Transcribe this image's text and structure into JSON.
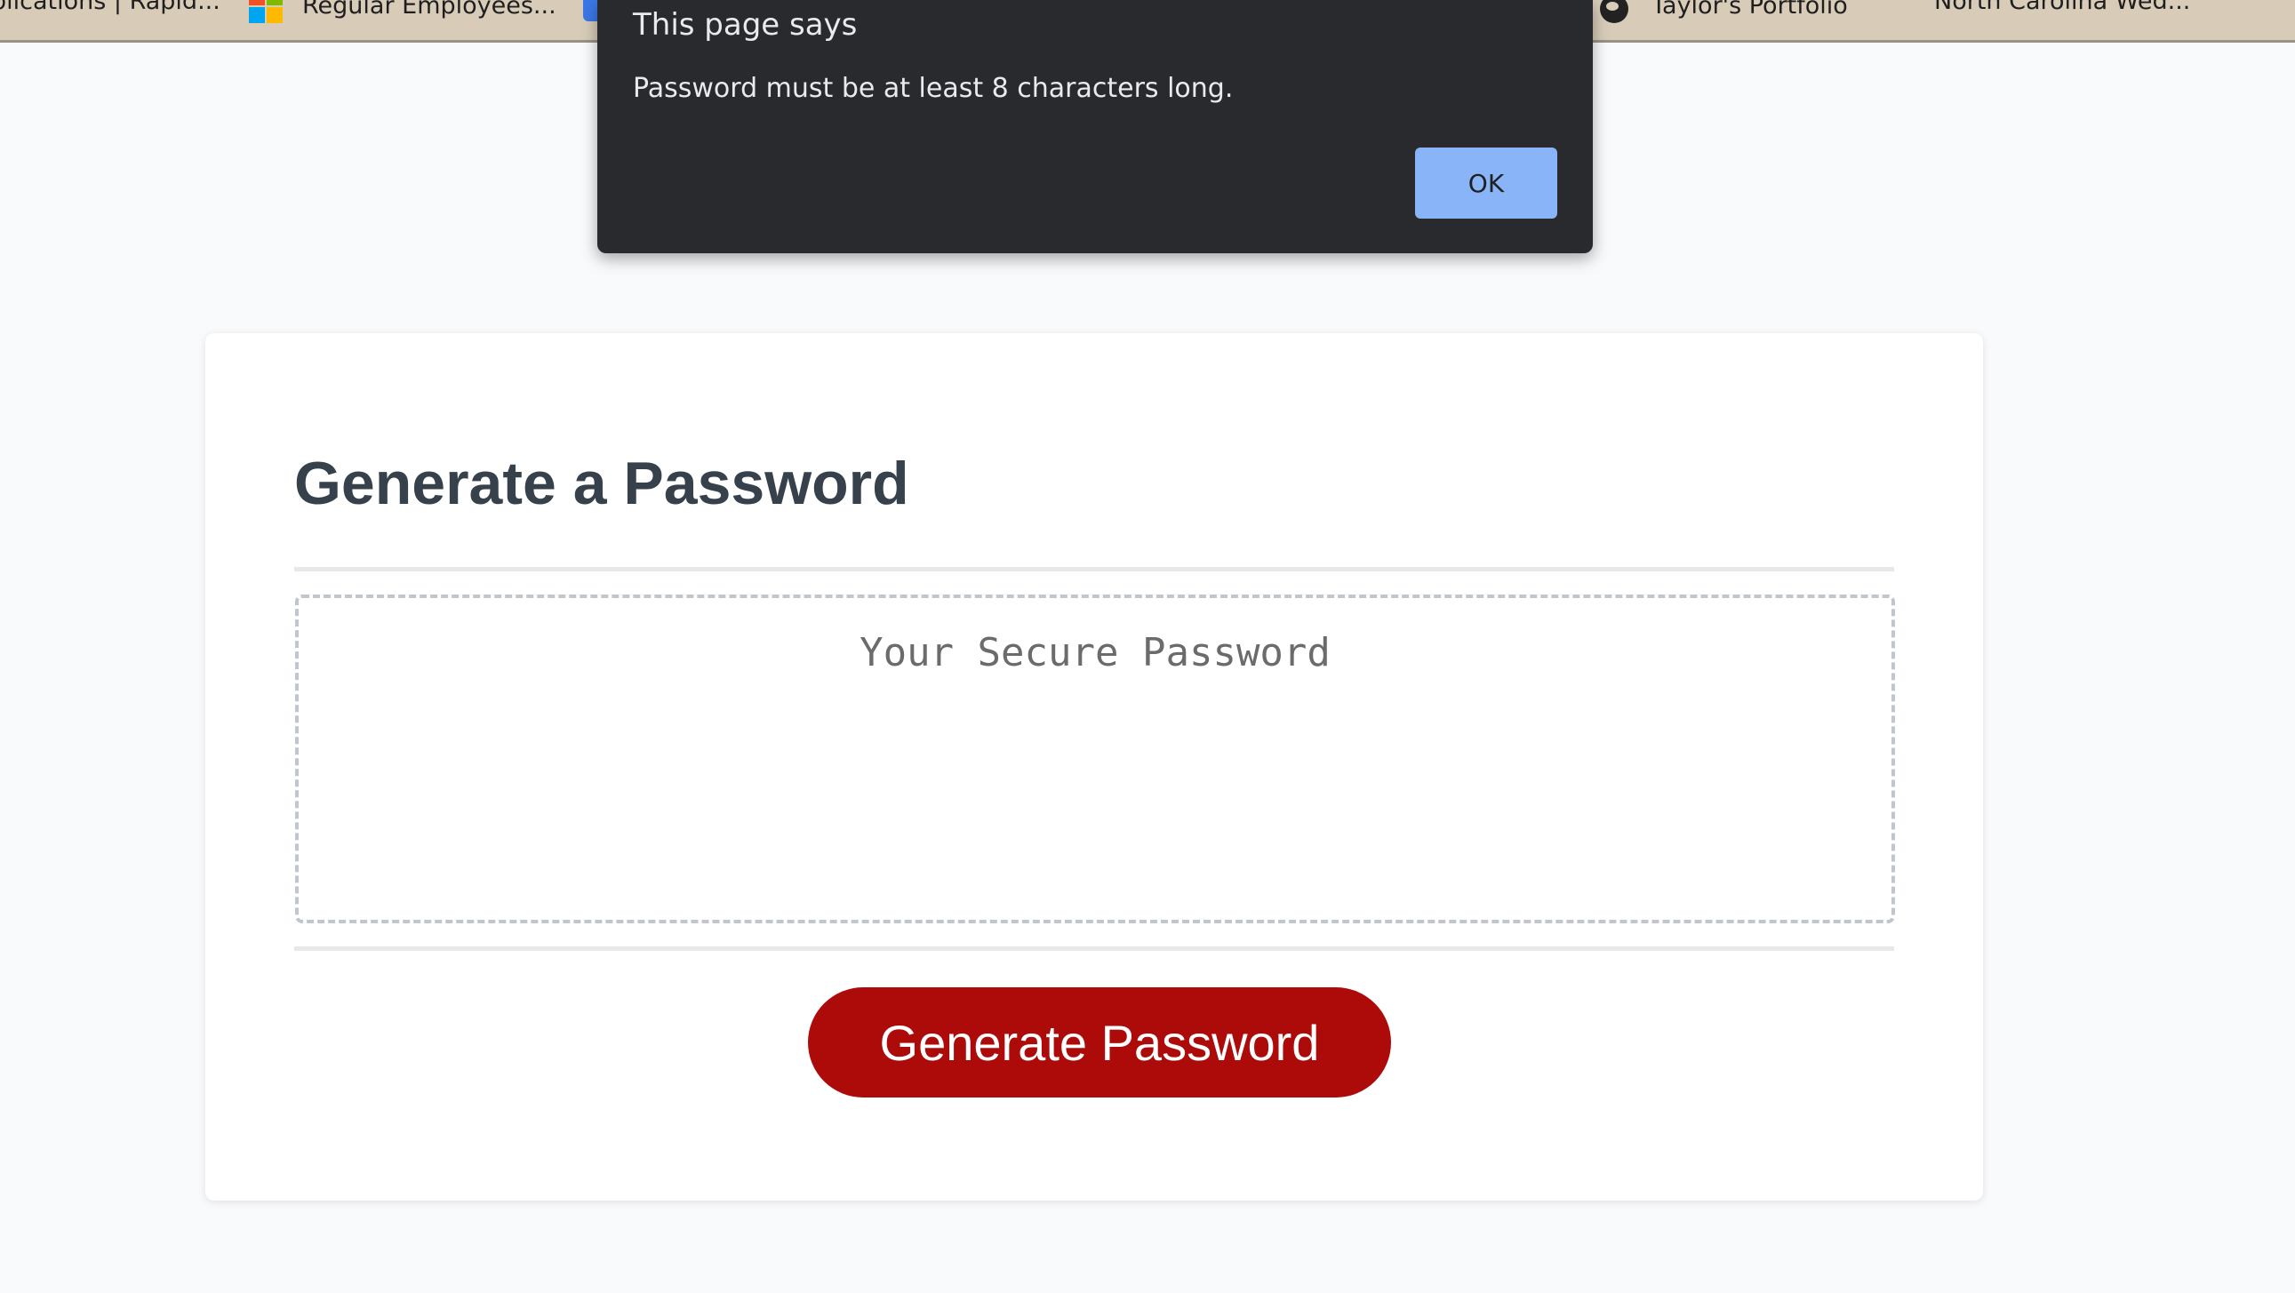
{
  "bookmarks": [
    {
      "label": "plications | Rapid..."
    },
    {
      "label": "Regular Employees..."
    },
    {
      "label": "Taylor's Portfolio"
    },
    {
      "label": "North Carolina Wed..."
    }
  ],
  "dialog": {
    "title": "This page says",
    "message": "Password must be at least 8 characters long.",
    "ok_label": "OK",
    "ok_color": "#8ab4f8",
    "background": "#292a2d"
  },
  "card": {
    "title": "Generate a Password",
    "password_placeholder": "Your Secure Password",
    "generate_label": "Generate Password",
    "button_color": "#ad0a0a"
  }
}
